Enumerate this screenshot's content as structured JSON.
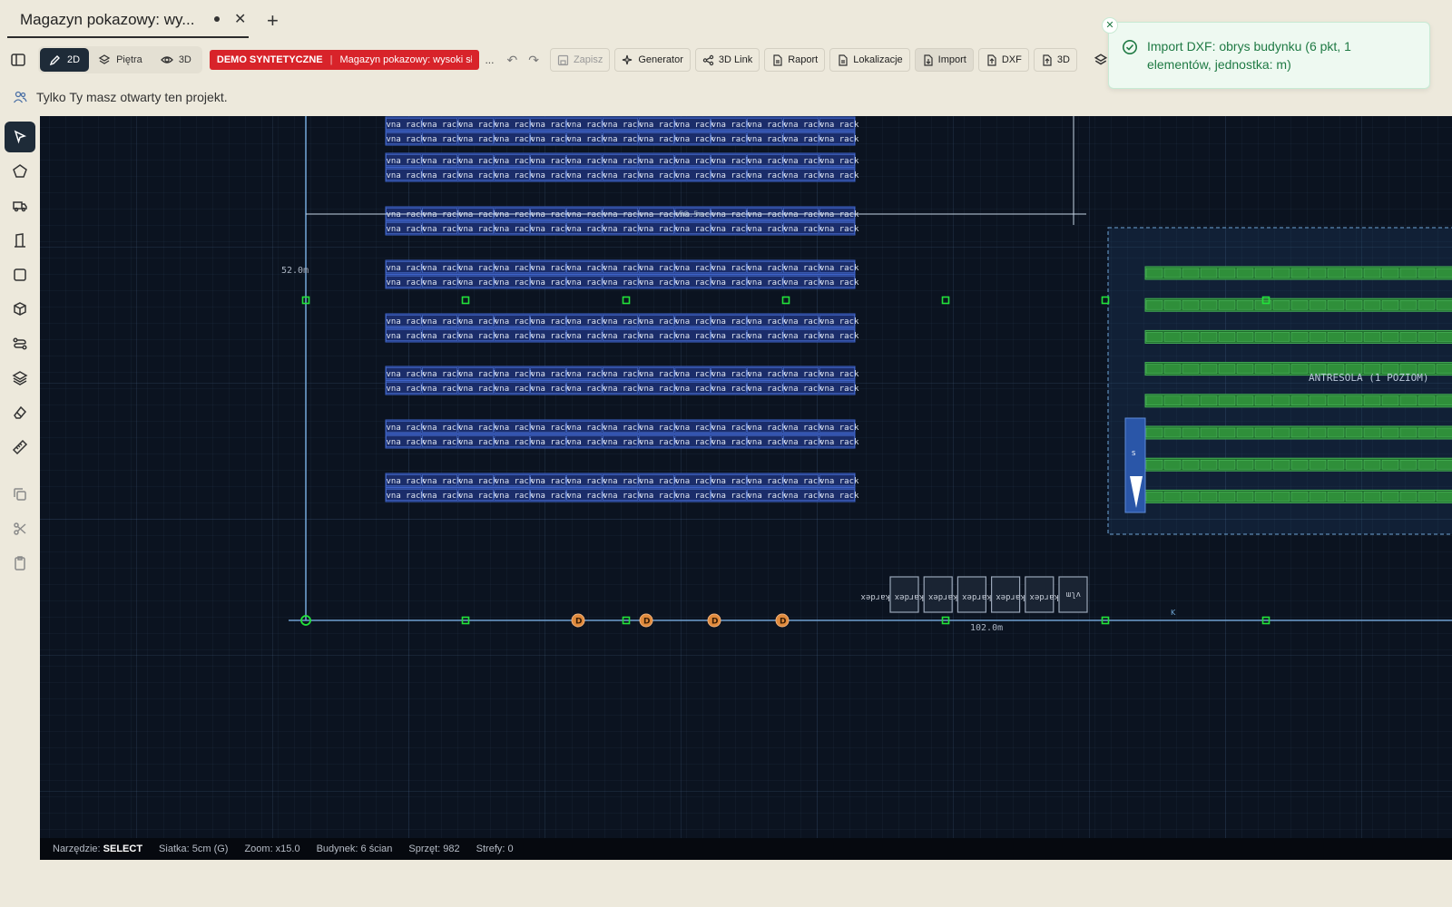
{
  "tab": {
    "title": "Magazyn pokazowy: wy...",
    "close": "✕",
    "new": "+"
  },
  "toolbar": {
    "mode_2d": "2D",
    "floors": "Piętra",
    "mode_3d": "3D",
    "demo_label": "DEMO SYNTETYCZNE",
    "demo_project": "Magazyn pokazowy: wysoki sł",
    "ellipsis": "...",
    "save": "Zapisz",
    "generator": "Generator",
    "link3d": "3D Link",
    "report": "Raport",
    "locations": "Lokalizacje",
    "import": "Import",
    "dxf": "DXF",
    "export3d": "3D"
  },
  "infobar": {
    "text": "Tylko Ty masz otwarty ten projekt."
  },
  "canvas": {
    "rack_text": "vna rack",
    "dim_width": "102.0m",
    "dim_height": "52.0m",
    "dim_overlay": "56.5m",
    "mezzanine_label": "ANTRESOLA (1 POZIOM)",
    "dock_label": "D",
    "kardex_label": "kardex",
    "vlm_label": "vlm",
    "k_label": "K",
    "s_label": "S"
  },
  "status": {
    "tool_label": "Narzędzie:",
    "tool_value": "SELECT",
    "grid": "Siatka: 5cm (G)",
    "zoom": "Zoom: x15.0",
    "building": "Budynek: 6 ścian",
    "equipment": "Sprzęt: 982",
    "zones": "Strefy: 0"
  },
  "toast": {
    "message": "Import DXF: obrys budynku (6 pkt, 1 elementów, jednostka: m)"
  },
  "colors": {
    "accent_dark": "#1e2b38",
    "demo_red": "#d8232a",
    "toast_green": "#1f7a44",
    "canvas_bg": "#0b1320",
    "rack_blue": "#2f4fb8",
    "green_rack": "#2f8f3a",
    "dock_orange": "#e08a3c"
  }
}
